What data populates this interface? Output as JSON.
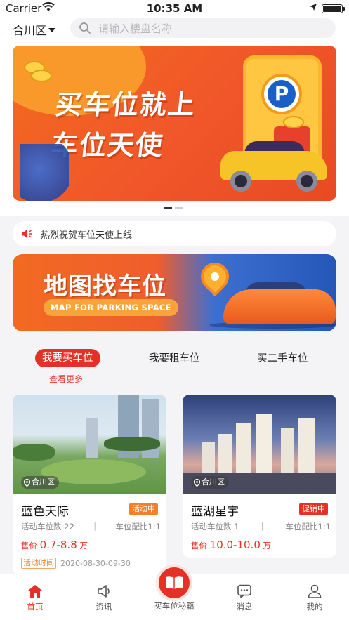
{
  "status_bar": {
    "carrier": "Carrier",
    "time": "10:35 AM"
  },
  "header": {
    "city": "合川区",
    "search_placeholder": "请输入楼盘名称"
  },
  "banner": {
    "title_line1": "买车位就上",
    "title_line2": "车位天使",
    "page_count": 2,
    "active_page": 1
  },
  "notice": {
    "text": "热烈祝贺车位天使上线"
  },
  "map_banner": {
    "title": "地图找车位",
    "subtitle": "MAP FOR PARKING SPACE"
  },
  "tabs": {
    "items": [
      "我要买车位",
      "我要租车位",
      "买二手车位"
    ],
    "more": "查看更多"
  },
  "listings": [
    {
      "name": "蓝色天际",
      "location": "合川区",
      "badge": "活动中",
      "badge_color": "#f0812a",
      "spots_label": "活动车位数",
      "spots": "22",
      "ratio_label": "车位配比",
      "ratio": "1:1",
      "price_label": "售价",
      "price": "0.7-8.8",
      "unit": "万",
      "date_label": "活动时间",
      "date": "2020-08-30-09-30"
    },
    {
      "name": "蓝湖星宇",
      "location": "合川区",
      "badge": "促销中",
      "badge_color": "#e63027",
      "spots_label": "活动车位数",
      "spots": "1",
      "ratio_label": "车位配比",
      "ratio": "1:1",
      "price_label": "售价",
      "price": "10.0-10.0",
      "unit": "万"
    }
  ],
  "tabbar": {
    "home": "首页",
    "news": "资讯",
    "guide": "买车位秘籍",
    "messages": "消息",
    "mine": "我的"
  },
  "accent": "#e63027"
}
